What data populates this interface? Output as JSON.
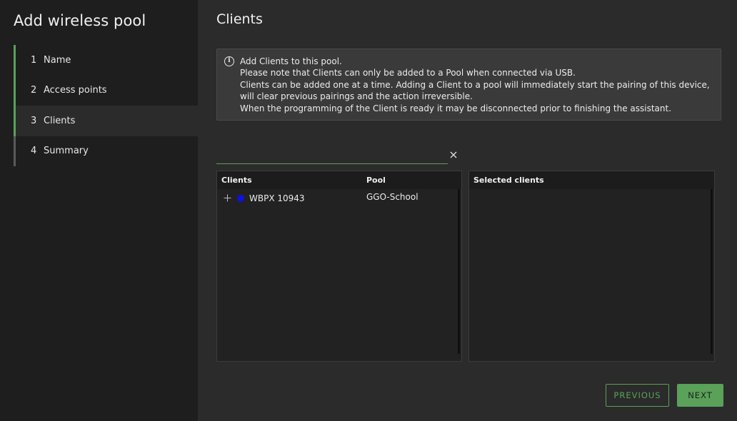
{
  "sidebar": {
    "title": "Add wireless pool",
    "steps": [
      {
        "num": "1",
        "label": "Name"
      },
      {
        "num": "2",
        "label": "Access points"
      },
      {
        "num": "3",
        "label": "Clients"
      },
      {
        "num": "4",
        "label": "Summary"
      }
    ],
    "active_step": 3
  },
  "main": {
    "title": "Clients",
    "info": {
      "icon": "info-icon",
      "lines": [
        "Add Clients to this pool.",
        "Please note that Clients can only be added to a Pool when connected via USB.",
        "Clients can be added one at a time. Adding a Client to a pool will immediately start the pairing of this device, will clear previous pairings and the action irreversible.",
        "When the programming of the Client is ready it may be disconnected prior to finishing the assistant."
      ]
    },
    "search": {
      "value": "",
      "placeholder": ""
    },
    "clients_table": {
      "headers": [
        "Clients",
        "Pool"
      ],
      "rows": [
        {
          "name": "WBPX 10943",
          "pool": "GGO-School",
          "status_color": "#1010e0"
        }
      ]
    },
    "selected_table": {
      "header": "Selected clients",
      "rows": []
    }
  },
  "buttons": {
    "previous": "PREVIOUS",
    "next": "NEXT"
  },
  "colors": {
    "accent": "#5aa15a",
    "sidebar_bg": "#1e1e1e",
    "main_bg": "#2b2b2b"
  }
}
